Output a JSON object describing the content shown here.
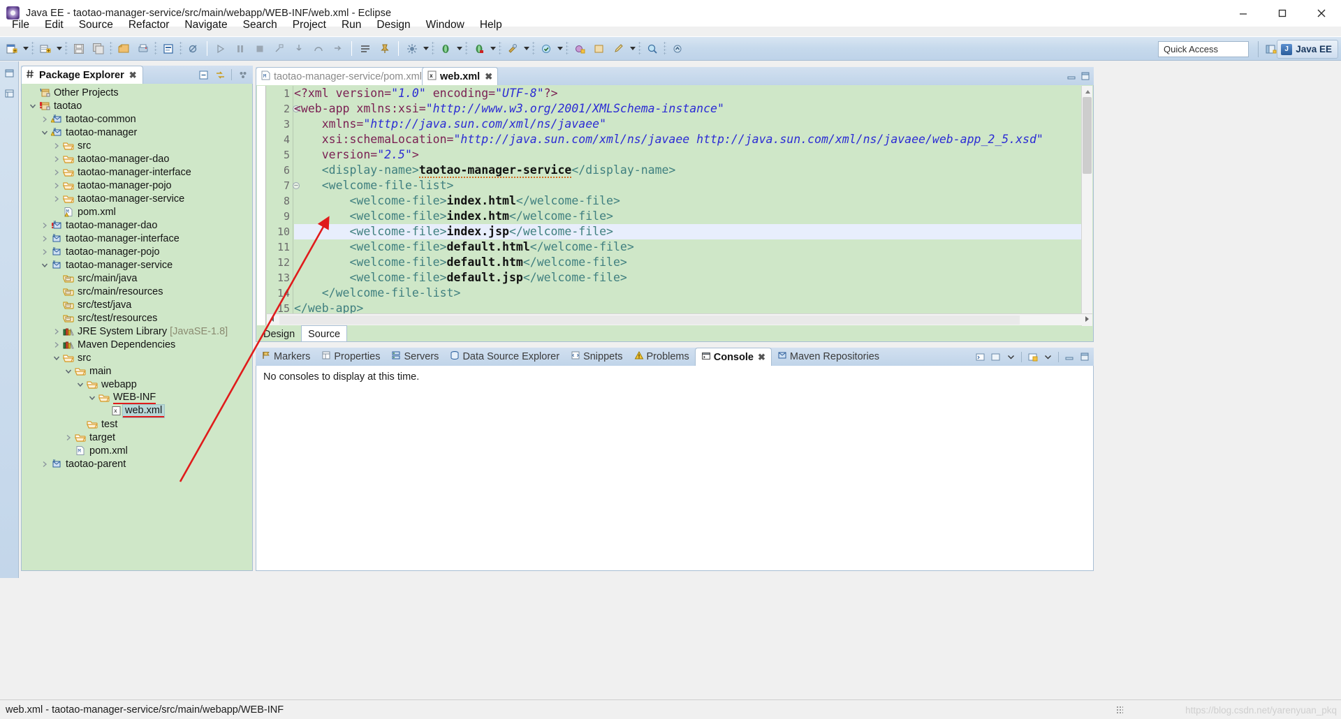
{
  "window": {
    "title": "Java EE - taotao-manager-service/src/main/webapp/WEB-INF/web.xml - Eclipse",
    "app_icon": "eclipse-icon",
    "minimize": "minimize-icon",
    "maximize": "maximize-icon",
    "close": "close-icon"
  },
  "menu": {
    "items": [
      {
        "label": "File"
      },
      {
        "label": "Edit"
      },
      {
        "label": "Source"
      },
      {
        "label": "Refactor"
      },
      {
        "label": "Navigate"
      },
      {
        "label": "Search"
      },
      {
        "label": "Project"
      },
      {
        "label": "Run"
      },
      {
        "label": "Design"
      },
      {
        "label": "Window"
      },
      {
        "label": "Help"
      }
    ]
  },
  "toolbar": {
    "quick_access_placeholder": "Quick Access",
    "perspective_label": "Java EE",
    "perspective_badge": "J"
  },
  "explorer": {
    "tab_label": "Package Explorer",
    "tab_icon": "package-explorer-icon",
    "close_icon": "close-icon",
    "tools": [
      {
        "name": "collapse-all-icon"
      },
      {
        "name": "link-with-editor-icon"
      },
      {
        "name": "view-menu-icon"
      }
    ],
    "tree": [
      {
        "label": "Other Projects",
        "indent": 1,
        "twist": "none",
        "icon": "java-project-icon"
      },
      {
        "label": "taotao",
        "indent": 1,
        "twist": "expanded",
        "icon": "error-project-icon"
      },
      {
        "label": "taotao-common",
        "indent": 2,
        "twist": "collapsed",
        "icon": "maven-warning-project-icon"
      },
      {
        "label": "taotao-manager",
        "indent": 2,
        "twist": "expanded",
        "icon": "maven-warning-project-icon"
      },
      {
        "label": "src",
        "indent": 3,
        "twist": "collapsed",
        "icon": "folder-icon"
      },
      {
        "label": "taotao-manager-dao",
        "indent": 3,
        "twist": "collapsed",
        "icon": "folder-icon"
      },
      {
        "label": "taotao-manager-interface",
        "indent": 3,
        "twist": "collapsed",
        "icon": "folder-icon"
      },
      {
        "label": "taotao-manager-pojo",
        "indent": 3,
        "twist": "collapsed",
        "icon": "folder-icon"
      },
      {
        "label": "taotao-manager-service",
        "indent": 3,
        "twist": "collapsed",
        "icon": "folder-icon"
      },
      {
        "label": "pom.xml",
        "indent": 3,
        "twist": "none",
        "icon": "maven-pom-warning-icon"
      },
      {
        "label": "taotao-manager-dao",
        "indent": 2,
        "twist": "collapsed",
        "icon": "maven-error-project-icon"
      },
      {
        "label": "taotao-manager-interface",
        "indent": 2,
        "twist": "collapsed",
        "icon": "maven-project-icon"
      },
      {
        "label": "taotao-manager-pojo",
        "indent": 2,
        "twist": "collapsed",
        "icon": "maven-project-icon"
      },
      {
        "label": "taotao-manager-service",
        "indent": 2,
        "twist": "expanded",
        "icon": "maven-project-icon"
      },
      {
        "label": "src/main/java",
        "indent": 3,
        "twist": "none",
        "icon": "source-folder-icon"
      },
      {
        "label": "src/main/resources",
        "indent": 3,
        "twist": "none",
        "icon": "source-folder-icon"
      },
      {
        "label": "src/test/java",
        "indent": 3,
        "twist": "none",
        "icon": "source-folder-icon"
      },
      {
        "label": "src/test/resources",
        "indent": 3,
        "twist": "none",
        "icon": "source-folder-icon"
      },
      {
        "label": "JRE System Library",
        "suffix": " [JavaSE-1.8]",
        "indent": 3,
        "twist": "collapsed",
        "icon": "library-icon"
      },
      {
        "label": "Maven Dependencies",
        "indent": 3,
        "twist": "collapsed",
        "icon": "library-icon"
      },
      {
        "label": "src",
        "indent": 3,
        "twist": "expanded",
        "icon": "folder-icon"
      },
      {
        "label": "main",
        "indent": 4,
        "twist": "expanded",
        "icon": "folder-icon"
      },
      {
        "label": "webapp",
        "indent": 5,
        "twist": "expanded",
        "icon": "folder-icon"
      },
      {
        "label": "WEB-INF",
        "indent": 6,
        "twist": "expanded",
        "icon": "folder-icon",
        "annotated": true
      },
      {
        "label": "web.xml",
        "indent": 7,
        "twist": "none",
        "icon": "xml-file-icon",
        "selected": true,
        "annotated": true
      },
      {
        "label": "test",
        "indent": 5,
        "twist": "none",
        "icon": "folder-icon"
      },
      {
        "label": "target",
        "indent": 4,
        "twist": "collapsed",
        "icon": "folder-icon"
      },
      {
        "label": "pom.xml",
        "indent": 4,
        "twist": "none",
        "icon": "maven-pom-icon"
      },
      {
        "label": "taotao-parent",
        "indent": 2,
        "twist": "collapsed",
        "icon": "maven-project-icon"
      }
    ]
  },
  "editor": {
    "tabs": [
      {
        "label": "taotao-manager-service/pom.xml",
        "icon": "maven-pom-icon",
        "active": false,
        "close_icon": "close-icon"
      },
      {
        "label": "web.xml",
        "icon": "xml-file-icon",
        "active": true,
        "close_icon": "close-icon"
      }
    ],
    "minimize_icon": "minimize-view-icon",
    "maximize_icon": "maximize-view-icon",
    "current_line": 10,
    "modes": [
      {
        "label": "Design",
        "active": false
      },
      {
        "label": "Source",
        "active": true
      }
    ],
    "lines": [
      {
        "n": 1,
        "fold": false,
        "segments": [
          {
            "t": "<?xml ",
            "c": "pi"
          },
          {
            "t": "version=",
            "c": "attr"
          },
          {
            "t": "\"1.0\"",
            "c": "val"
          },
          {
            "t": " encoding=",
            "c": "attr"
          },
          {
            "t": "\"UTF-8\"",
            "c": "val"
          },
          {
            "t": "?>",
            "c": "pi"
          }
        ]
      },
      {
        "n": 2,
        "fold": true,
        "segments": [
          {
            "t": "<web-app ",
            "c": "tagname"
          },
          {
            "t": "xmlns:xsi=",
            "c": "attr"
          },
          {
            "t": "\"http://www.w3.org/2001/XMLSchema-instance\"",
            "c": "val"
          }
        ]
      },
      {
        "n": 3,
        "fold": false,
        "segments": [
          {
            "t": "    xmlns=",
            "c": "attr"
          },
          {
            "t": "\"http://java.sun.com/xml/ns/javaee\"",
            "c": "val"
          }
        ]
      },
      {
        "n": 4,
        "fold": false,
        "segments": [
          {
            "t": "    xsi:schemaLocation=",
            "c": "attr"
          },
          {
            "t": "\"http://java.sun.com/xml/ns/javaee http://java.sun.com/xml/ns/javaee/web-app_2_5.xsd\"",
            "c": "val"
          }
        ]
      },
      {
        "n": 5,
        "fold": false,
        "segments": [
          {
            "t": "    version=",
            "c": "attr"
          },
          {
            "t": "\"2.5\"",
            "c": "val"
          },
          {
            "t": ">",
            "c": "tagname"
          }
        ]
      },
      {
        "n": 6,
        "fold": false,
        "segments": [
          {
            "t": "    <display-name>",
            "c": "tag"
          },
          {
            "t": "taotao-manager-service",
            "c": "txt spell"
          },
          {
            "t": "</display-name>",
            "c": "tag"
          }
        ]
      },
      {
        "n": 7,
        "fold": true,
        "segments": [
          {
            "t": "    <welcome-file-list>",
            "c": "tag"
          }
        ]
      },
      {
        "n": 8,
        "fold": false,
        "segments": [
          {
            "t": "        <welcome-file>",
            "c": "tag"
          },
          {
            "t": "index.html",
            "c": "txt"
          },
          {
            "t": "</welcome-file>",
            "c": "tag"
          }
        ]
      },
      {
        "n": 9,
        "fold": false,
        "segments": [
          {
            "t": "        <welcome-file>",
            "c": "tag"
          },
          {
            "t": "index.htm",
            "c": "txt"
          },
          {
            "t": "</welcome-file>",
            "c": "tag"
          }
        ]
      },
      {
        "n": 10,
        "fold": false,
        "current": true,
        "segments": [
          {
            "t": "        <welcome-file>",
            "c": "tag"
          },
          {
            "t": "index.jsp",
            "c": "txt"
          },
          {
            "t": "</welcome-file>",
            "c": "tag"
          }
        ]
      },
      {
        "n": 11,
        "fold": false,
        "segments": [
          {
            "t": "        <welcome-file>",
            "c": "tag"
          },
          {
            "t": "default.html",
            "c": "txt"
          },
          {
            "t": "</welcome-file>",
            "c": "tag"
          }
        ]
      },
      {
        "n": 12,
        "fold": false,
        "segments": [
          {
            "t": "        <welcome-file>",
            "c": "tag"
          },
          {
            "t": "default.htm",
            "c": "txt"
          },
          {
            "t": "</welcome-file>",
            "c": "tag"
          }
        ]
      },
      {
        "n": 13,
        "fold": false,
        "segments": [
          {
            "t": "        <welcome-file>",
            "c": "tag"
          },
          {
            "t": "default.jsp",
            "c": "txt"
          },
          {
            "t": "</welcome-file>",
            "c": "tag"
          }
        ]
      },
      {
        "n": 14,
        "fold": false,
        "segments": [
          {
            "t": "    </welcome-file-list>",
            "c": "tag"
          }
        ]
      },
      {
        "n": 15,
        "fold": false,
        "segments": [
          {
            "t": "</web-app>",
            "c": "tag"
          }
        ]
      }
    ]
  },
  "console_panel": {
    "tabs": [
      {
        "label": "Markers",
        "icon": "markers-icon",
        "active": false
      },
      {
        "label": "Properties",
        "icon": "properties-icon",
        "active": false
      },
      {
        "label": "Servers",
        "icon": "servers-icon",
        "active": false
      },
      {
        "label": "Data Source Explorer",
        "icon": "datasource-icon",
        "active": false
      },
      {
        "label": "Snippets",
        "icon": "snippets-icon",
        "active": false
      },
      {
        "label": "Problems",
        "icon": "problems-icon",
        "active": false
      },
      {
        "label": "Console",
        "icon": "console-icon",
        "active": true,
        "close_icon": "close-icon"
      },
      {
        "label": "Maven Repositories",
        "icon": "maven-repo-icon",
        "active": false
      }
    ],
    "tools": [
      {
        "name": "open-console-icon"
      },
      {
        "name": "display-console-icon"
      },
      {
        "name": "new-console-view-icon"
      },
      {
        "name": "minimize-view-icon"
      },
      {
        "name": "maximize-view-icon"
      }
    ],
    "message": "No consoles to display at this time."
  },
  "statusbar": {
    "text": "web.xml - taotao-manager-service/src/main/webapp/WEB-INF",
    "watermark": "https://blog.csdn.net/yarenyuan_pkq"
  },
  "colors": {
    "editor_background": "#cfe7c8",
    "tree_background": "#cfe7c8",
    "toolbar": "#c6d9ec",
    "tag": "#3f7f7f",
    "attribute": "#7a1f52",
    "value": "#2b2bd4",
    "current_line": "#e8eefc",
    "selection": "#b8d8d8",
    "annotation_red": "#e01b1b"
  }
}
